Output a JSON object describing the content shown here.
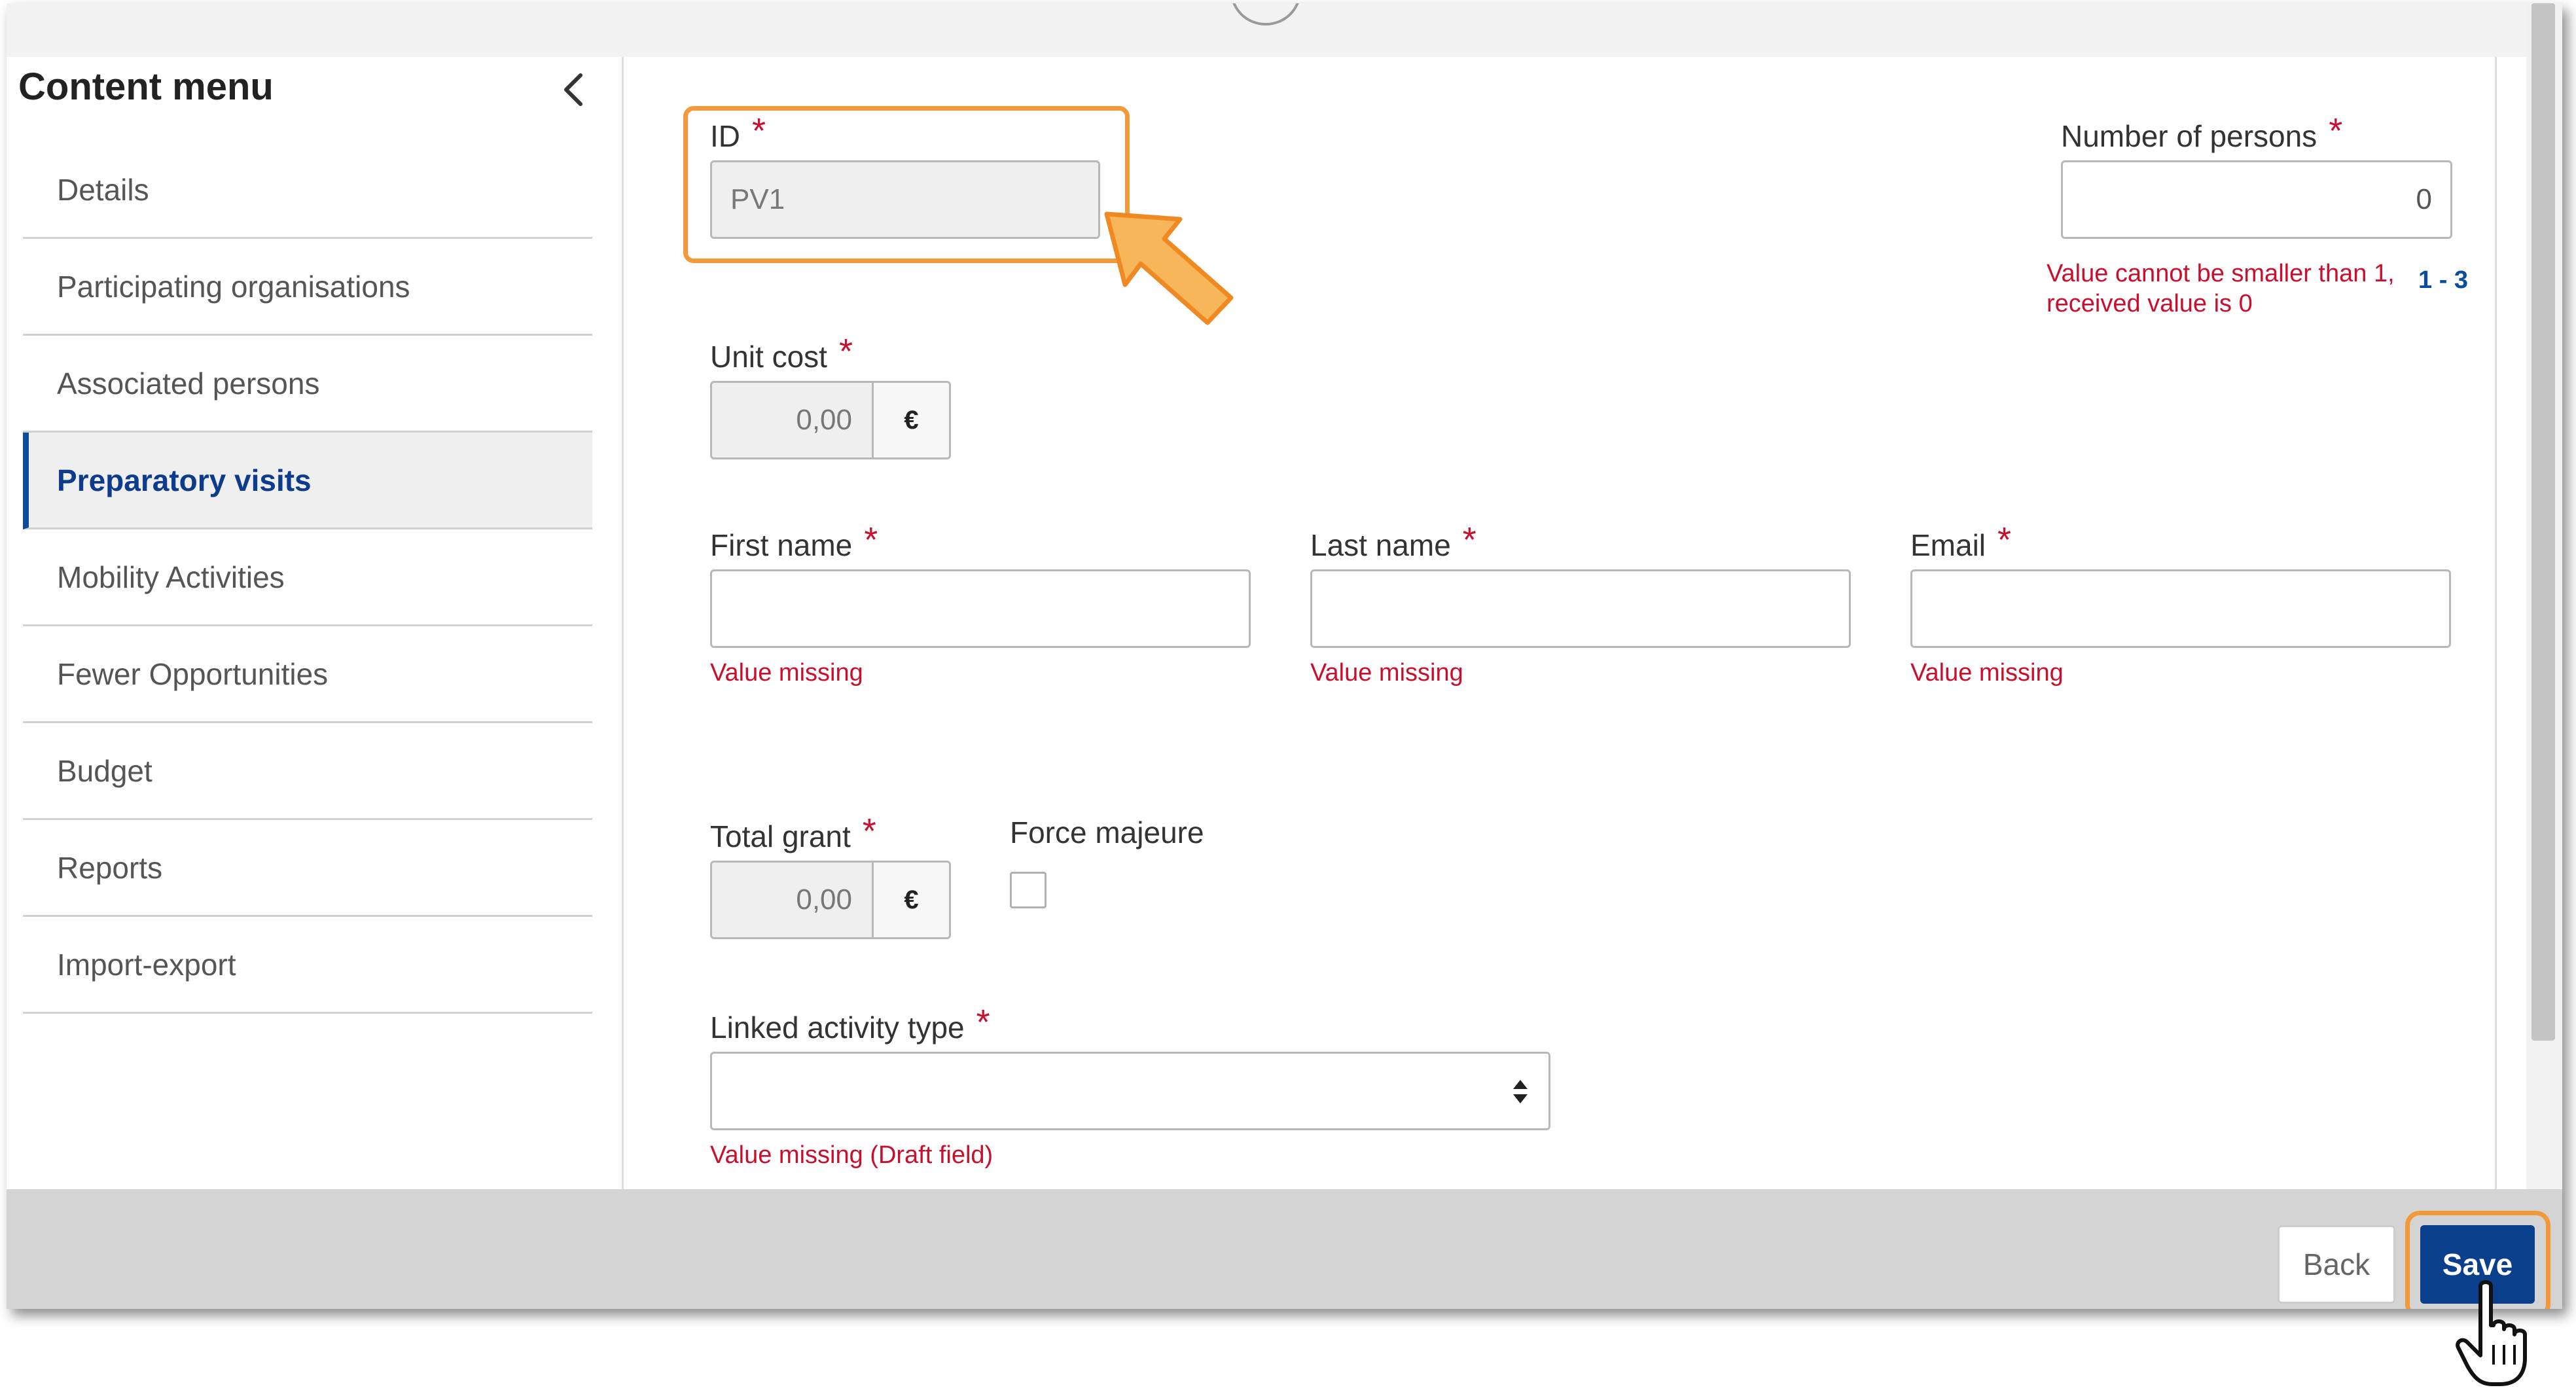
{
  "sidebar": {
    "title": "Content menu",
    "items": [
      {
        "label": "Details"
      },
      {
        "label": "Participating organisations"
      },
      {
        "label": "Associated persons"
      },
      {
        "label": "Preparatory visits",
        "active": true
      },
      {
        "label": "Mobility Activities"
      },
      {
        "label": "Fewer Opportunities"
      },
      {
        "label": "Budget"
      },
      {
        "label": "Reports"
      },
      {
        "label": "Import-export"
      }
    ]
  },
  "form": {
    "id": {
      "label": "ID",
      "value": "PV1"
    },
    "persons": {
      "label": "Number of persons",
      "value": "0",
      "error_line1": "Value cannot be smaller than 1,",
      "error_line2": "received value is 0",
      "range": "1 - 3"
    },
    "unit_cost": {
      "label": "Unit cost",
      "value": "0,00",
      "currency": "€"
    },
    "first_name": {
      "label": "First name",
      "value": "",
      "error": "Value missing"
    },
    "last_name": {
      "label": "Last name",
      "value": "",
      "error": "Value missing"
    },
    "email": {
      "label": "Email",
      "value": "",
      "error": "Value missing"
    },
    "total_grant": {
      "label": "Total grant",
      "value": "0,00",
      "currency": "€"
    },
    "force_majeure": {
      "label": "Force majeure",
      "checked": false
    },
    "linked_activity": {
      "label": "Linked activity type",
      "value": "",
      "error": "Value missing (Draft field)"
    },
    "required_mark": "*"
  },
  "footer": {
    "back_label": "Back",
    "save_label": "Save"
  },
  "colors": {
    "accent": "#0a3f8c",
    "error": "#c8102e",
    "highlight": "#f29a3a",
    "active_text": "#0d3c8c"
  },
  "icons": {
    "collapse": "chevron-left-icon",
    "select": "select-arrows-icon",
    "pointer": "hand-pointer-icon",
    "callout": "arrow-callout-icon"
  }
}
